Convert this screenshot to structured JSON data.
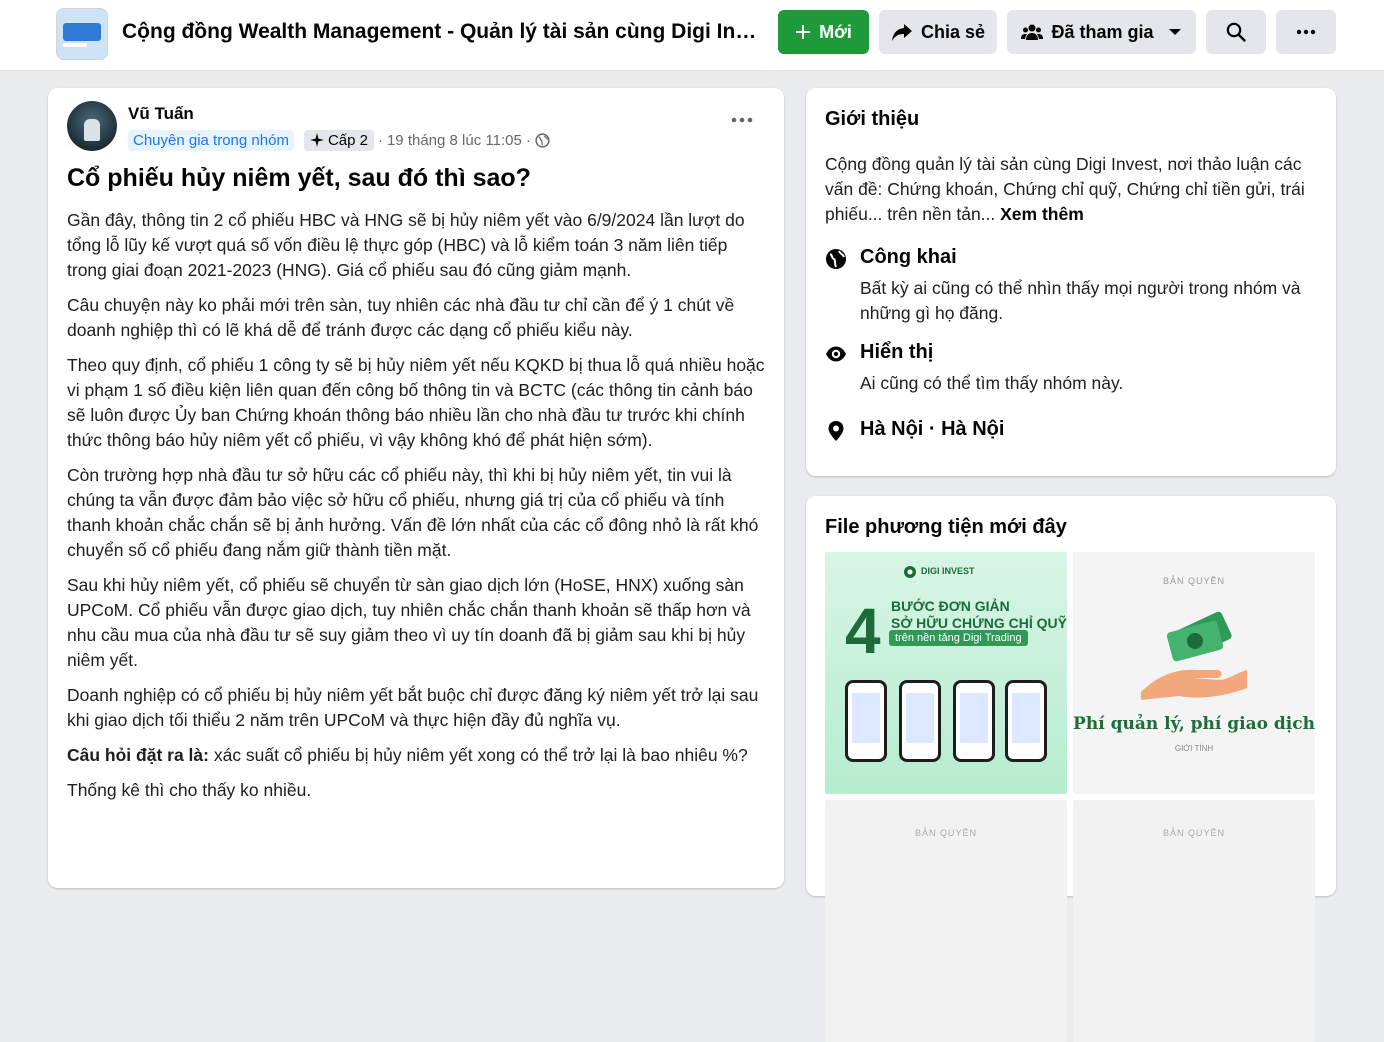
{
  "header": {
    "group_title": "Cộng đồng Wealth Management - Quản lý tài sản cùng Digi Investment",
    "new_label": "Mới",
    "share_label": "Chia sẻ",
    "joined_label": "Đã tham gia"
  },
  "post": {
    "author": "Vũ Tuấn",
    "role_badge": "Chuyên gia trong nhóm",
    "level_badge": "Cấp 2",
    "timestamp": "19 tháng 8 lúc 11:05",
    "title": "Cổ phiếu hủy niêm yết, sau đó thì sao?",
    "paragraphs": [
      "Gần đây, thông tin 2 cổ phiếu HBC và HNG sẽ bị hủy niêm yết vào 6/9/2024 lần lượt do tổng lỗ lũy kế vượt quá số vốn điều lệ thực góp (HBC) và lỗ kiểm toán 3 năm liên tiếp trong giai đoạn 2021-2023 (HNG). Giá cổ phiếu sau đó cũng giảm mạnh.",
      "Câu chuyện này ko phải mới trên sàn, tuy nhiên các nhà đầu tư chỉ cần để ý 1 chút về doanh nghiệp thì có lẽ khá dễ để tránh được các dạng cổ phiếu kiểu này.",
      "Theo quy định, cổ phiếu 1 công ty sẽ bị hủy niêm yết nếu KQKD bị thua lỗ quá nhiều hoặc vi phạm 1 số điều kiện liên quan đến công bố thông tin và BCTC (các thông tin cảnh báo sẽ luôn được Ủy ban Chứng khoán thông báo nhiều lần cho nhà đầu tư trước khi chính thức thông báo hủy niêm yết cổ phiếu, vì vậy không khó để phát hiện sớm).",
      "Còn trường hợp nhà đầu tư sở hữu các cổ phiếu này, thì khi bị hủy niêm yết, tin vui là chúng ta vẫn được đảm bảo việc sở hữu cổ phiếu, nhưng giá trị của cổ phiếu và tính thanh khoản chắc chắn sẽ bị ảnh hưởng. Vấn đề lớn nhất của các cổ đông nhỏ là rất khó chuyển số cổ phiếu đang nắm giữ thành tiền mặt.",
      "Sau khi hủy niêm yết, cổ phiếu sẽ chuyển từ sàn giao dịch lớn (HoSE, HNX) xuống sàn UPCoM. Cổ phiếu vẫn được giao dịch, tuy nhiên chắc chắn thanh khoản sẽ thấp hơn và nhu cầu mua của nhà đầu tư sẽ suy giảm theo vì uy tín doanh đã bị giảm sau khi bị hủy niêm yết.",
      "Doanh nghiệp có cổ phiếu bị hủy niêm yết bắt buộc chỉ được đăng ký niêm yết trở lại sau khi giao dịch tối thiểu 2 năm trên UPCoM và thực hiện đầy đủ nghĩa vụ."
    ],
    "question_label": "Câu hỏi đặt ra là:",
    "question_text": " xác suất cổ phiếu bị hủy niêm yết xong có thể trở lại là bao nhiêu %?",
    "closing": "Thống kê thì cho thấy ko nhiều."
  },
  "about": {
    "heading": "Giới thiệu",
    "description": "Cộng đồng quản lý tài sản cùng Digi Invest, nơi thảo luận các vấn đề: Chứng khoán, Chứng chỉ quỹ, Chứng chỉ tiền gửi, trái phiếu... trên nền tản... ",
    "see_more": "Xem thêm",
    "public_title": "Công khai",
    "public_desc": "Bất kỳ ai cũng có thể nhìn thấy mọi người trong nhóm và những gì họ đăng.",
    "visible_title": "Hiển thị",
    "visible_desc": "Ai cũng có thể tìm thấy nhóm này.",
    "location": "Hà Nội · Hà Nội"
  },
  "media": {
    "heading": "File phương tiện mới đây",
    "tile1_brand": "DIGI INVEST",
    "tile1_number": "4",
    "tile1_headline_1": "BƯỚC ĐƠN GIẢN",
    "tile1_headline_2": "SỞ HỮU CHỨNG CHỈ QUỸ",
    "tile1_sub": "trên nền tảng Digi Trading",
    "tile2_watermark": "BẢN QUYỀN",
    "tile2_caption": "Phí quản lý, phí giao dịch",
    "tile2_small": "GIỚI TÍNH",
    "tile3_watermark": "BẢN QUYỀN",
    "tile4_watermark": "BẢN QUYỀN"
  },
  "colors": {
    "accent_green": "#1f9a3a",
    "link_blue": "#1877f2",
    "page_bg": "#e9ebee"
  }
}
